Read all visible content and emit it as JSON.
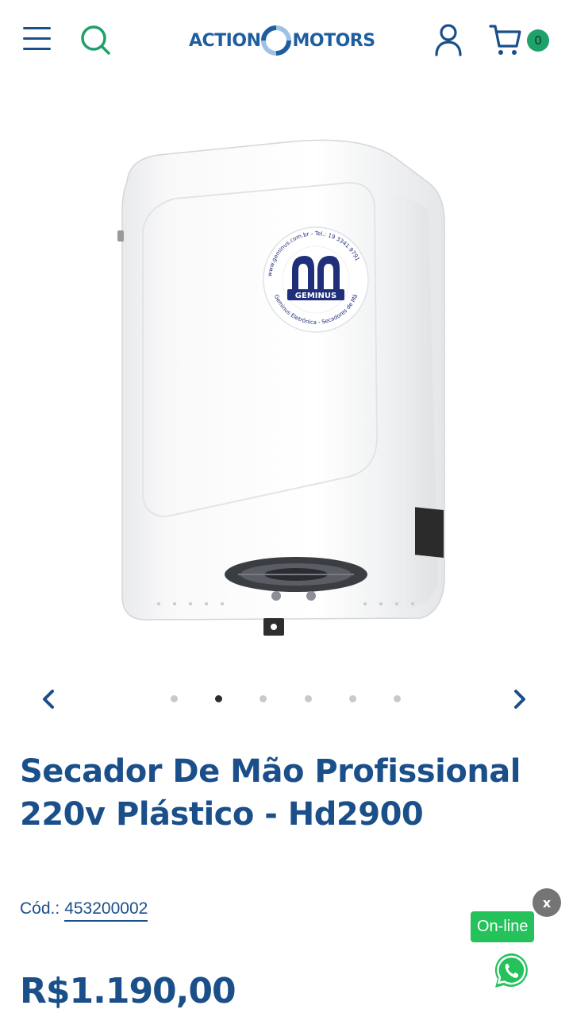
{
  "header": {
    "logo_left": "ACTION",
    "logo_right": "MOTORS",
    "cart_count": "0"
  },
  "gallery": {
    "image_description_alt": "",
    "dots": [
      false,
      true,
      false,
      false,
      false,
      false
    ],
    "image_text": {
      "brand": "GEMINUS",
      "ring_top": "www.geminus.com.br - Tel.: 19 3341.9791",
      "ring_bottom": "Geminus Eletrônica - Secadores de Mão"
    }
  },
  "product": {
    "title": "Secador De Mão Profissional 220v Plástico - Hd2900",
    "code_label": "Cód.:",
    "code_value": "453200002",
    "price": "R$1.190,00"
  },
  "chat_widget": {
    "close_label": "x",
    "status_label": "On-line"
  },
  "colors": {
    "brand_blue": "#1b4f8a",
    "accent_green": "#1fa16b",
    "whatsapp_green": "#25c15b"
  },
  "icons": [
    "menu-icon",
    "search-icon",
    "user-icon",
    "cart-icon",
    "chevron-left-icon",
    "chevron-right-icon",
    "whatsapp-icon"
  ]
}
